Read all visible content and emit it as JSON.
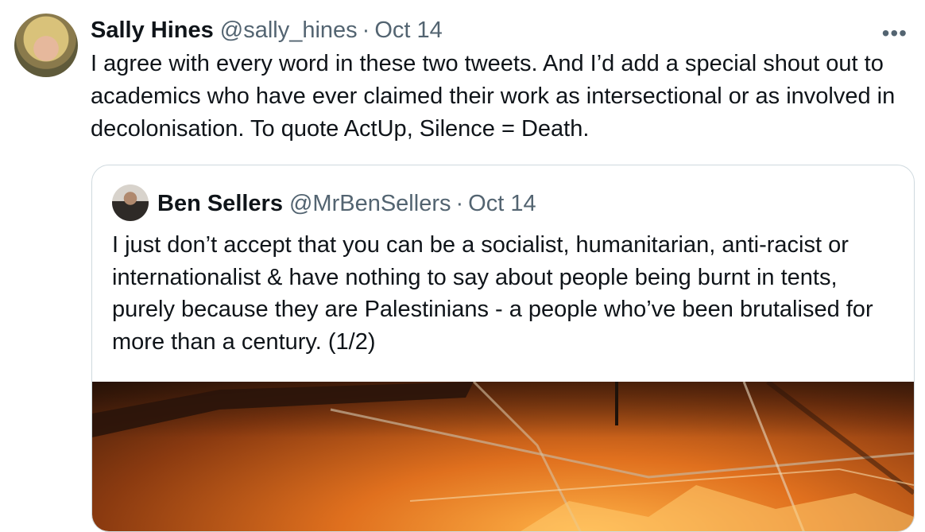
{
  "tweet": {
    "author_name": "Sally Hines",
    "author_handle": "@sally_hines",
    "separator": "·",
    "date": "Oct 14",
    "more_label": "•••",
    "text": "I agree with every word in these two tweets. And I’d add a special shout out to academics who have ever claimed their work as intersectional or as involved in decolonisation. To quote ActUp, Silence = Death."
  },
  "quoted_tweet": {
    "author_name": "Ben Sellers",
    "author_handle": "@MrBenSellers",
    "separator": "·",
    "date": "Oct 14",
    "text": "I just don’t accept that you can be a socialist, humanitarian, anti-racist or internationalist & have nothing to say about people being burnt in tents, purely because they are Palestinians - a people who’ve been brutalised for more than a century. (1/2)"
  },
  "colors": {
    "text_primary": "#0f1419",
    "text_secondary": "#536471",
    "border": "#cfd9de"
  }
}
